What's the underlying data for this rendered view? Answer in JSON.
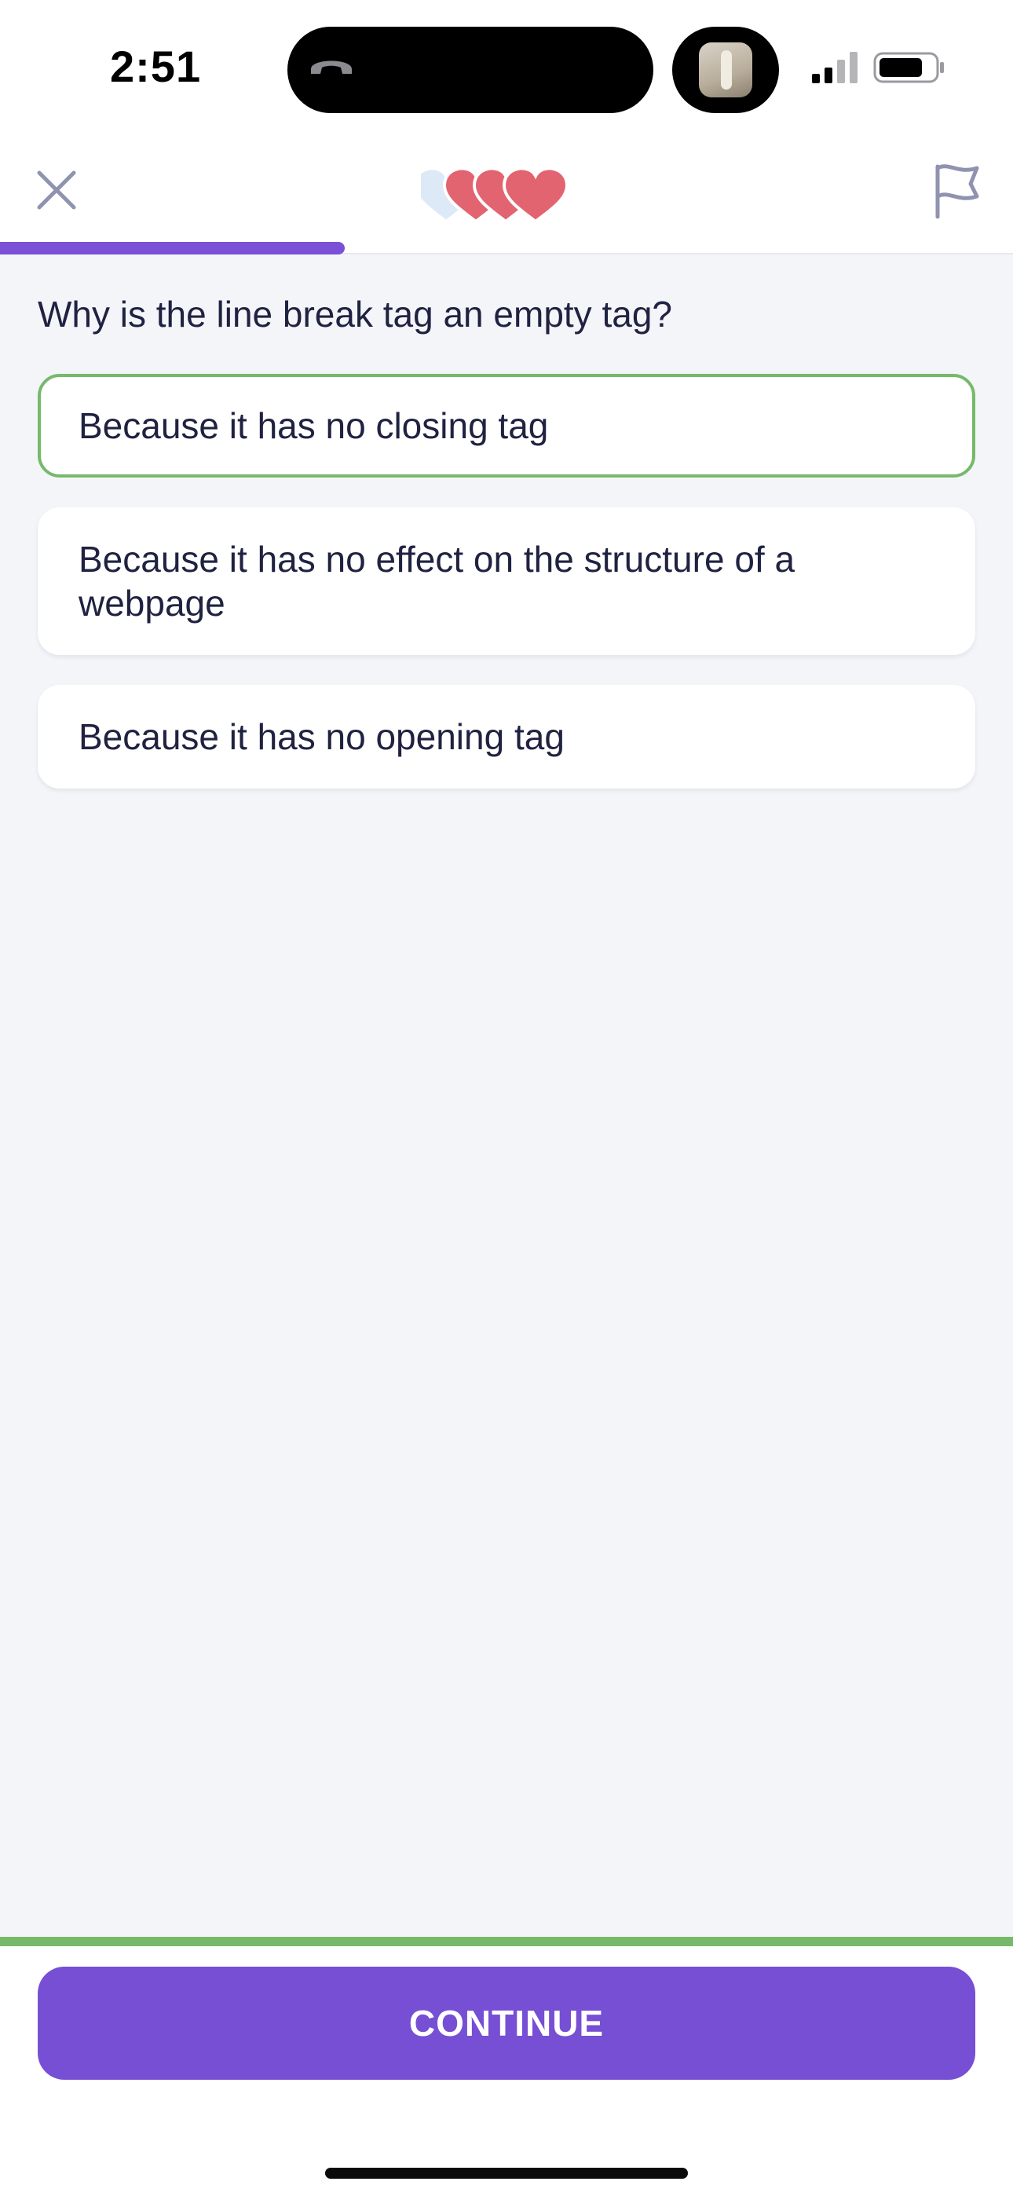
{
  "status_bar": {
    "time": "2:51",
    "signal_bars": 2,
    "signal_bars_total": 4,
    "battery_level": 0.8
  },
  "header": {
    "close_icon": "close-icon",
    "flag_icon": "flag-icon",
    "hearts_total": 4,
    "hearts_filled": 3,
    "heart_color": "#e26470",
    "heart_empty_color": "#dde9f7",
    "progress": 0.34,
    "progress_color": "#7b4fd6"
  },
  "question": {
    "text": "Why is the line break tag an empty tag?"
  },
  "options": [
    {
      "label": "Because it has no closing tag",
      "selected": true
    },
    {
      "label": "Because it has no effect on the structure of a webpage",
      "selected": false
    },
    {
      "label": "Because it has no opening tag",
      "selected": false
    }
  ],
  "footer": {
    "continue_label": "CONTINUE",
    "accent_color": "#77b96a",
    "button_color": "#764fd4"
  }
}
